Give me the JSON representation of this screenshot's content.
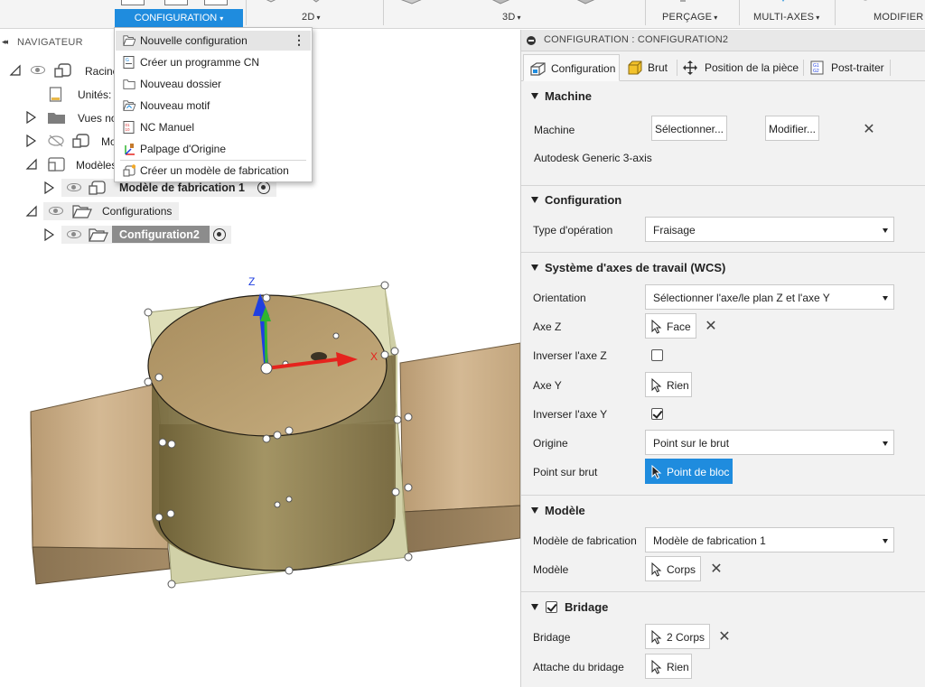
{
  "toolbar": {
    "groups": [
      {
        "label": "CONFIGURATION",
        "active": true
      },
      {
        "label": "2D"
      },
      {
        "label": "3D"
      },
      {
        "label": "PERÇAGE"
      },
      {
        "label": "MULTI-AXES"
      },
      {
        "label": "MODIFIER"
      }
    ],
    "caret": "▾"
  },
  "navigator": {
    "header": "NAVIGATEUR",
    "collapse_glyph": "◂◂",
    "items": [
      {
        "label": "Racine",
        "clipped": true
      },
      {
        "label": "Unités: r",
        "clipped": true
      },
      {
        "label": "Vues no",
        "clipped": true
      },
      {
        "label": "Mo",
        "clipped": true
      },
      {
        "label": "Modèles",
        "clipped": true
      },
      {
        "label": "Modèle de fabrication 1"
      },
      {
        "label": "Configurations"
      },
      {
        "label": "Configuration2",
        "selected": true
      }
    ]
  },
  "dropdown": {
    "items": [
      {
        "label": "Nouvelle configuration",
        "icon": "folder-open-icon",
        "highlighted": true
      },
      {
        "label": "Créer un programme CN",
        "icon": "nc-program-icon"
      },
      {
        "label": "Nouveau dossier",
        "icon": "folder-icon"
      },
      {
        "label": "Nouveau motif",
        "icon": "pattern-icon"
      },
      {
        "label": "NC Manuel",
        "icon": "manual-nc-icon"
      },
      {
        "label": "Palpage d'Origine",
        "icon": "probe-icon"
      },
      {
        "label": "Créer un modèle de fabrication",
        "icon": "manufacturing-model-icon"
      }
    ],
    "more_glyph": "⋮"
  },
  "panel": {
    "title": "CONFIGURATION : CONFIGURATION2",
    "tabs": [
      {
        "label": "Configuration",
        "active": true
      },
      {
        "label": "Brut"
      },
      {
        "label": "Position de la pièce"
      },
      {
        "label": "Post-traiter"
      }
    ],
    "machine": {
      "heading": "Machine",
      "label": "Machine",
      "select_btn": "Sélectionner...",
      "modify_btn": "Modifier...",
      "name": "Autodesk Generic 3-axis"
    },
    "configuration": {
      "heading": "Configuration",
      "op_type_label": "Type d'opération",
      "op_type_value": "Fraisage"
    },
    "wcs": {
      "heading": "Système d'axes de travail (WCS)",
      "orientation_label": "Orientation",
      "orientation_value": "Sélectionner l'axe/le plan Z et l'axe Y",
      "axe_z_label": "Axe Z",
      "axe_z_value": "Face",
      "invert_z_label": "Inverser l'axe Z",
      "invert_z_checked": false,
      "axe_y_label": "Axe Y",
      "axe_y_value": "Rien",
      "invert_y_label": "Inverser l'axe Y",
      "invert_y_checked": true,
      "origin_label": "Origine",
      "origin_value": "Point sur le brut",
      "point_label": "Point sur brut",
      "point_value": "Point de bloc"
    },
    "model": {
      "heading": "Modèle",
      "fab_label": "Modèle de fabrication",
      "fab_value": "Modèle de fabrication 1",
      "model_label": "Modèle",
      "model_value": "Corps"
    },
    "fixture": {
      "heading": "Bridage",
      "checked": true,
      "fixture_label": "Bridage",
      "fixture_value": "2 Corps",
      "attach_label": "Attache du bridage",
      "attach_value": "Rien"
    },
    "close_glyph": "✕"
  },
  "viewport": {
    "axis_z": "Z",
    "axis_x": "X",
    "colors": {
      "x_axis": "#e5231d",
      "y_axis": "#2fb52f",
      "z_axis": "#1f3fe0",
      "stock": "#cfcf9a",
      "wood_light": "#c9ad84",
      "wood_dark": "#8f7a56"
    }
  }
}
